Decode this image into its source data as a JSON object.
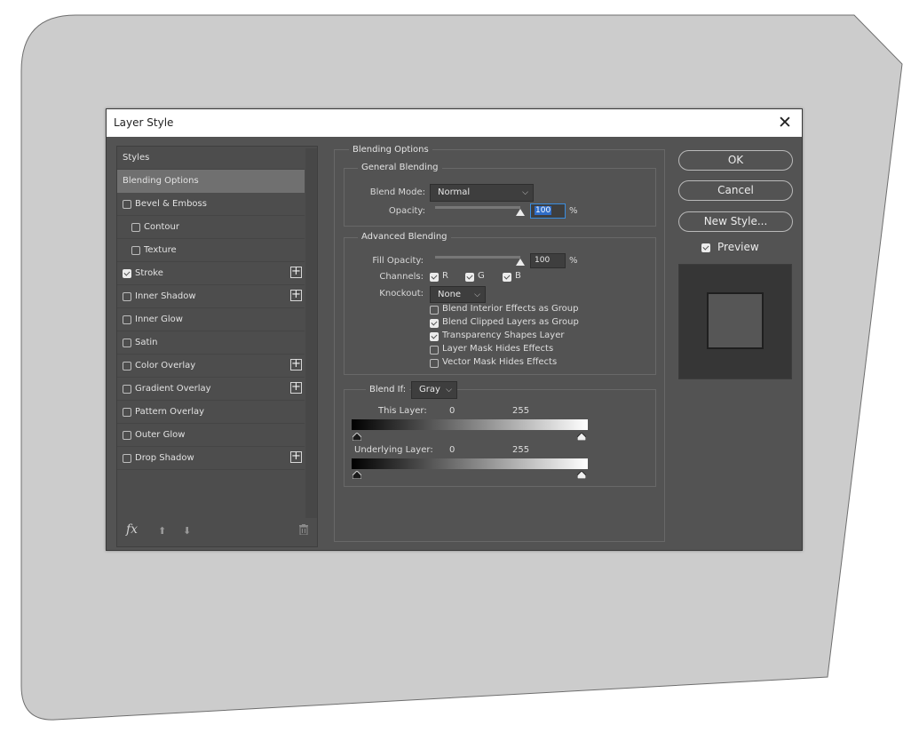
{
  "dialog": {
    "title": "Layer Style",
    "close_glyph": "✕"
  },
  "styles_panel": {
    "header": "Styles",
    "items": [
      {
        "label": "Blending Options",
        "checkbox": false,
        "checked": false,
        "plus": false,
        "indent": 0,
        "selected": true
      },
      {
        "label": "Bevel & Emboss",
        "checkbox": true,
        "checked": false,
        "plus": false,
        "indent": 0
      },
      {
        "label": "Contour",
        "checkbox": true,
        "checked": false,
        "plus": false,
        "indent": 1
      },
      {
        "label": "Texture",
        "checkbox": true,
        "checked": false,
        "plus": false,
        "indent": 1
      },
      {
        "label": "Stroke",
        "checkbox": true,
        "checked": true,
        "plus": true,
        "indent": 0
      },
      {
        "label": "Inner Shadow",
        "checkbox": true,
        "checked": false,
        "plus": true,
        "indent": 0
      },
      {
        "label": "Inner Glow",
        "checkbox": true,
        "checked": false,
        "plus": false,
        "indent": 0
      },
      {
        "label": "Satin",
        "checkbox": true,
        "checked": false,
        "plus": false,
        "indent": 0
      },
      {
        "label": "Color Overlay",
        "checkbox": true,
        "checked": false,
        "plus": true,
        "indent": 0
      },
      {
        "label": "Gradient Overlay",
        "checkbox": true,
        "checked": false,
        "plus": true,
        "indent": 0
      },
      {
        "label": "Pattern Overlay",
        "checkbox": true,
        "checked": false,
        "plus": false,
        "indent": 0
      },
      {
        "label": "Outer Glow",
        "checkbox": true,
        "checked": false,
        "plus": false,
        "indent": 0
      },
      {
        "label": "Drop Shadow",
        "checkbox": true,
        "checked": false,
        "plus": true,
        "indent": 0
      }
    ],
    "footer": {
      "fx_label": "fx",
      "icons": [
        "fx-icon",
        "move-up-icon",
        "move-down-icon",
        "trash-icon"
      ]
    }
  },
  "blending_options": {
    "section_title": "Blending Options",
    "general": {
      "title": "General Blending",
      "blend_mode_label": "Blend Mode:",
      "blend_mode_value": "Normal",
      "opacity_label": "Opacity:",
      "opacity_value": "100",
      "opacity_slider_fraction": 1.0,
      "percent": "%"
    },
    "advanced": {
      "title": "Advanced Blending",
      "fill_opacity_label": "Fill Opacity:",
      "fill_opacity_value": "100",
      "fill_opacity_slider_fraction": 1.0,
      "percent": "%",
      "channels_label": "Channels:",
      "channels": [
        {
          "label": "R",
          "checked": true
        },
        {
          "label": "G",
          "checked": true
        },
        {
          "label": "B",
          "checked": true
        }
      ],
      "knockout_label": "Knockout:",
      "knockout_value": "None",
      "options": [
        {
          "label": "Blend Interior Effects as Group",
          "checked": false
        },
        {
          "label": "Blend Clipped Layers as Group",
          "checked": true
        },
        {
          "label": "Transparency Shapes Layer",
          "checked": true
        },
        {
          "label": "Layer Mask Hides Effects",
          "checked": false
        },
        {
          "label": "Vector Mask Hides Effects",
          "checked": false
        }
      ]
    },
    "blend_if": {
      "label": "Blend If:",
      "value": "Gray",
      "this_layer": {
        "label": "This Layer:",
        "min": "0",
        "max": "255"
      },
      "underlying_layer": {
        "label": "Underlying Layer:",
        "min": "0",
        "max": "255"
      }
    }
  },
  "buttons": {
    "ok": "OK",
    "cancel": "Cancel",
    "new_style": "New Style..."
  },
  "preview": {
    "label": "Preview",
    "checked": true
  },
  "colors": {
    "dialog_bg": "#535353",
    "panel_bg": "#4d4d4d",
    "selected_row": "#707070",
    "backdrop": "#cccccc",
    "focus_accent": "#3a8de0"
  }
}
